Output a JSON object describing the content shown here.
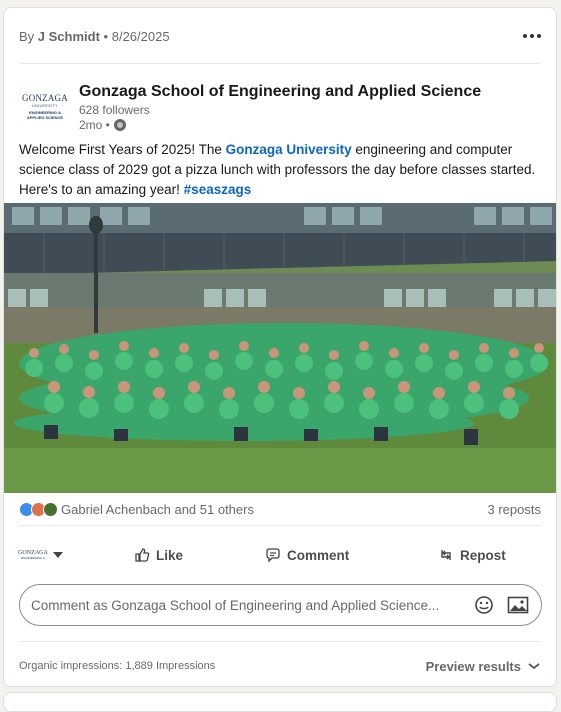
{
  "post": {
    "author_prefix": "By",
    "author": "J Schmidt",
    "separator": "•",
    "date": "8/26/2025"
  },
  "org": {
    "logo_line1": "GONZAGA",
    "logo_line2": "UNIVERSITY",
    "logo_line3": "ENGINEERING &",
    "logo_line4": "APPLIED SCIENCE",
    "name": "Gonzaga School of Engineering and Applied Science",
    "followers": "628 followers",
    "time": "2mo •"
  },
  "content": {
    "text1": "Welcome First Years of 2025! The ",
    "link1": "Gonzaga University",
    "text2": " engineering and computer science class of 2029 got a pizza lunch with professors the day before classes started. Here's to an amazing year! ",
    "hashtag": "#seaszags"
  },
  "social": {
    "reactions_text": "Gabriel Achenbach and 51 others",
    "reposts": "3 reposts"
  },
  "actions": {
    "like": "Like",
    "comment": "Comment",
    "repost": "Repost"
  },
  "comment_box": {
    "placeholder": "Comment as Gonzaga School of Engineering and Applied Science..."
  },
  "footer": {
    "impressions": "Organic impressions: 1,889 Impressions",
    "preview": "Preview results"
  },
  "colors": {
    "link": "#0a66c2",
    "shirt": "#3aa66b",
    "grass": "#5f8a3c"
  }
}
